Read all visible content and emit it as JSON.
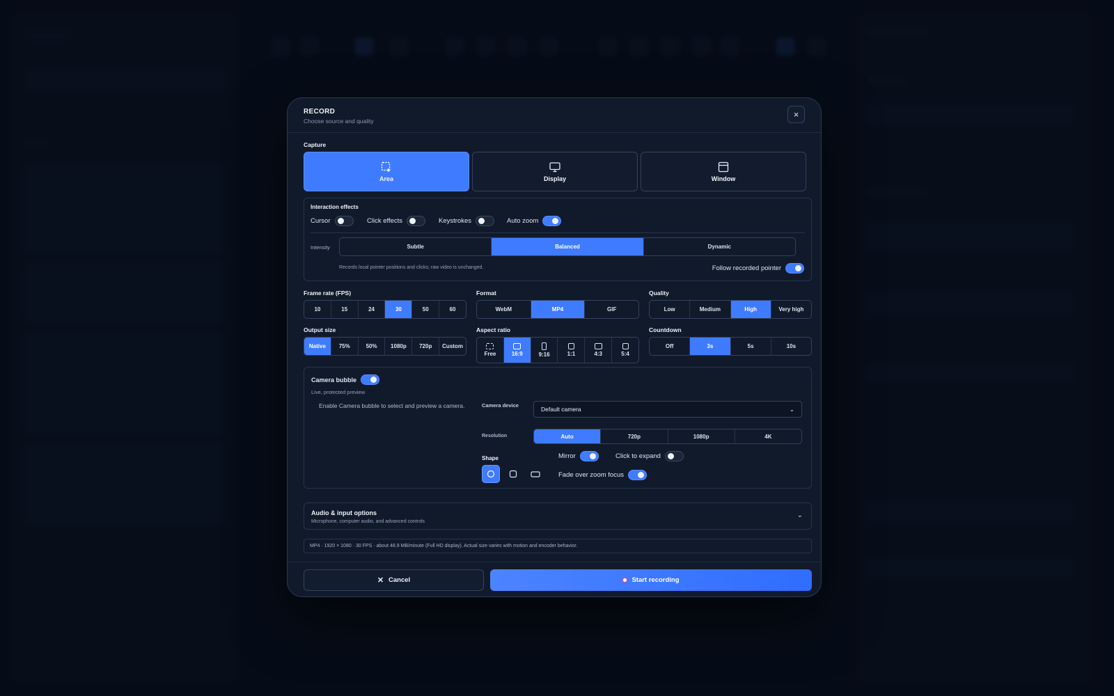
{
  "modal": {
    "title": "RECORD",
    "subtitle": "Choose source and quality",
    "close_icon": "×"
  },
  "capture": {
    "label": "Capture",
    "options": [
      {
        "label": "Area",
        "icon": "area-select-icon",
        "active": true
      },
      {
        "label": "Display",
        "icon": "monitor-icon",
        "active": false
      },
      {
        "label": "Window",
        "icon": "window-icon",
        "active": false
      }
    ]
  },
  "interaction": {
    "label": "Interaction effects",
    "toggles": [
      {
        "label": "Cursor",
        "on": false
      },
      {
        "label": "Click effects",
        "on": false
      },
      {
        "label": "Keystrokes",
        "on": false
      },
      {
        "label": "Auto zoom",
        "on": true
      }
    ],
    "intensity_label": "Intensity",
    "intensity_options": [
      "Subtle",
      "Balanced",
      "Dynamic"
    ],
    "intensity_selected": "Balanced",
    "note": "Records local pointer positions and clicks; raw video is unchanged.",
    "follow_label": "Follow recorded pointer",
    "follow_on": true
  },
  "frame_rate": {
    "label": "Frame rate (FPS)",
    "options": [
      "10",
      "15",
      "24",
      "30",
      "50",
      "60"
    ],
    "selected": "30"
  },
  "format": {
    "label": "Format",
    "options": [
      "WebM",
      "MP4",
      "GIF"
    ],
    "selected": "MP4"
  },
  "quality": {
    "label": "Quality",
    "options": [
      "Low",
      "Medium",
      "High",
      "Very high"
    ],
    "selected": "High"
  },
  "output_size": {
    "label": "Output size",
    "options": [
      "Native",
      "75%",
      "50%",
      "1080p",
      "720p",
      "Custom"
    ],
    "selected": "Native"
  },
  "aspect_ratio": {
    "label": "Aspect ratio",
    "options": [
      "Free",
      "16:9",
      "9:16",
      "1:1",
      "4:3",
      "5:4"
    ],
    "selected": "16:9"
  },
  "countdown": {
    "label": "Countdown",
    "options": [
      "Off",
      "3s",
      "5s",
      "10s"
    ],
    "selected": "3s"
  },
  "camera": {
    "label": "Camera bubble",
    "on": true,
    "sub": "Live, protected preview",
    "hint": "Enable Camera bubble to select and preview a camera.",
    "device_label": "Camera device",
    "device_value": "Default camera",
    "resolution_label": "Resolution",
    "resolution_options": [
      "Auto",
      "720p",
      "1080p",
      "4K"
    ],
    "resolution_selected": "Auto",
    "shape_label": "Shape",
    "mirror_label": "Mirror",
    "mirror_on": true,
    "expand_label": "Click to expand",
    "expand_on": false,
    "fade_label": "Fade over zoom focus",
    "fade_on": true
  },
  "audio": {
    "title": "Audio & input options",
    "sub": "Microphone, computer audio, and advanced controls"
  },
  "summary": "MP4 · 1920 × 1080 · 30 FPS · about 48.9 MB/minute (Full HD display). Actual size varies with motion and encoder behavior.",
  "buttons": {
    "cancel": "Cancel",
    "start": "Start recording"
  },
  "colors": {
    "accent": "#3f7bff",
    "record": "#ff4d5e",
    "panel": "#111a2b"
  }
}
